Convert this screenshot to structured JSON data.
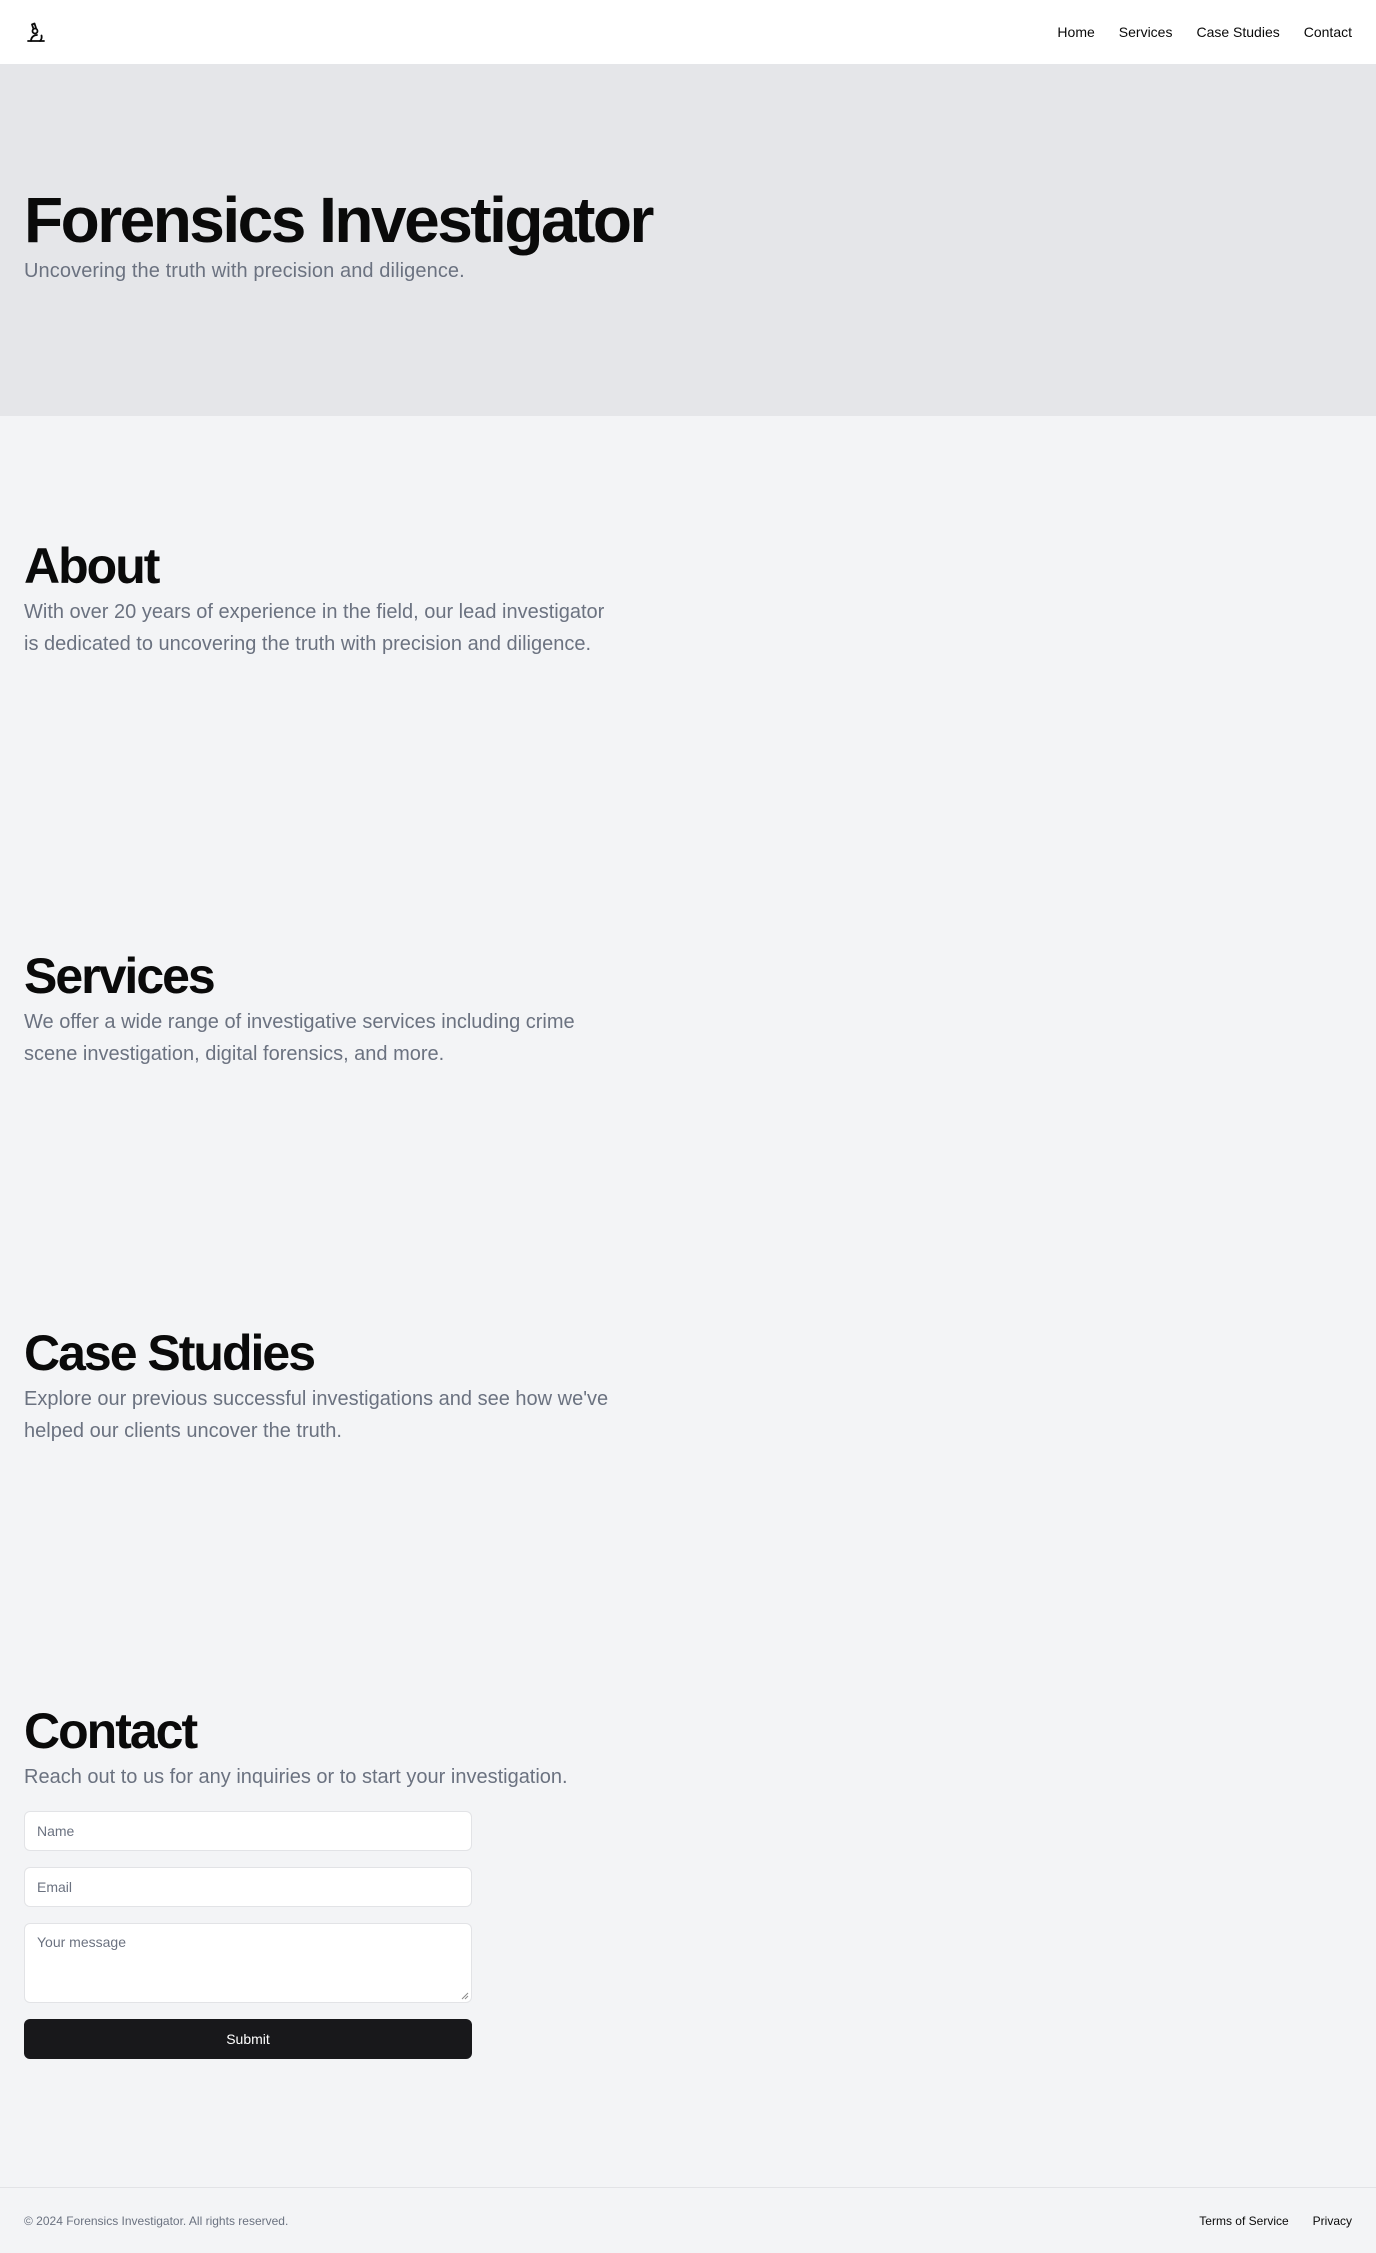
{
  "header": {
    "logo_icon": "microscope-icon",
    "nav": [
      {
        "label": "Home"
      },
      {
        "label": "Services"
      },
      {
        "label": "Case Studies"
      },
      {
        "label": "Contact"
      }
    ]
  },
  "hero": {
    "title": "Forensics Investigator",
    "subtitle": "Uncovering the truth with precision and diligence."
  },
  "about": {
    "title": "About",
    "text": "With over 20 years of experience in the field, our lead investigator is dedicated to uncovering the truth with precision and diligence."
  },
  "services": {
    "title": "Services",
    "text": "We offer a wide range of investigative services including crime scene investigation, digital forensics, and more."
  },
  "case_studies": {
    "title": "Case Studies",
    "text": "Explore our previous successful investigations and see how we've helped our clients uncover the truth."
  },
  "contact": {
    "title": "Contact",
    "text": "Reach out to us for any inquiries or to start your investigation.",
    "name_placeholder": "Name",
    "email_placeholder": "Email",
    "message_placeholder": "Your message",
    "submit_label": "Submit"
  },
  "footer": {
    "copyright": "© 2024 Forensics Investigator. All rights reserved.",
    "links": [
      {
        "label": "Terms of Service"
      },
      {
        "label": "Privacy"
      }
    ]
  },
  "colors": {
    "hero_bg": "#e5e6e9",
    "page_bg": "#f3f4f6",
    "button_bg": "#18181b",
    "muted_text": "#6b7280"
  }
}
